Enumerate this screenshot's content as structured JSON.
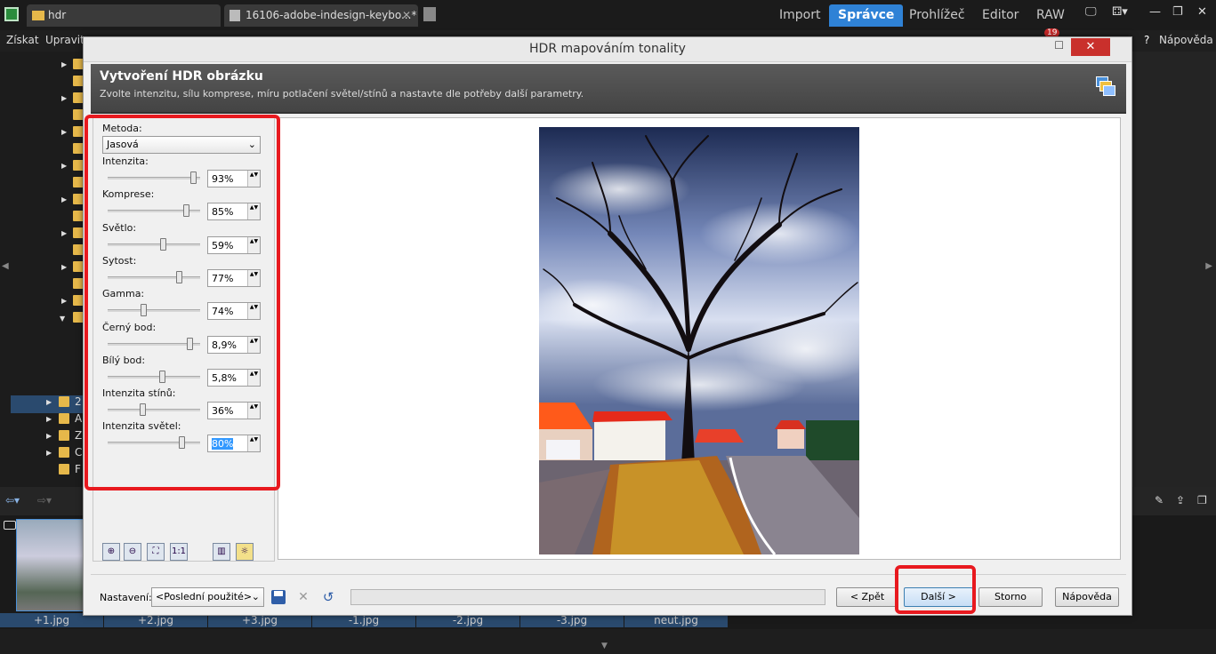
{
  "app": {
    "tabs": [
      {
        "label": "hdr"
      },
      {
        "label": "16106-adobe-indesign-keybo...*"
      }
    ],
    "modes": [
      "Import",
      "Správce",
      "Prohlížeč",
      "Editor",
      "RAW"
    ],
    "active_mode": "Správce",
    "menu": {
      "get": "Získat",
      "edit": "Upravit",
      "help": "Nápověda"
    },
    "notification_count": "19"
  },
  "filmstrip": {
    "files": [
      "+1.jpg",
      "+2.jpg",
      "+3.jpg",
      "-1.jpg",
      "-2.jpg",
      "-3.jpg",
      "neut.jpg"
    ]
  },
  "tree": {
    "labels": [
      "2",
      "A",
      "Z",
      "C",
      "F"
    ]
  },
  "dialog": {
    "title": "HDR mapováním tonality",
    "header_title": "Vytvoření HDR obrázku",
    "header_subtitle": "Zvolte intenzitu, sílu komprese, míru potlačení světel/stínů a nastavte dle potřeby další parametry.",
    "method_label": "Metoda:",
    "method_value": "Jasová",
    "sliders": [
      {
        "label": "Intenzita:",
        "value": "93%",
        "level": 0.93
      },
      {
        "label": "Komprese:",
        "value": "85%",
        "level": 0.85
      },
      {
        "label": "Světlo:",
        "value": "59%",
        "level": 0.59
      },
      {
        "label": "Sytost:",
        "value": "77%",
        "level": 0.77
      },
      {
        "label": "Gamma:",
        "value": "74%",
        "level": 0.37
      },
      {
        "label": "Černý bod:",
        "value": "8,9%",
        "level": 0.89
      },
      {
        "label": "Bílý bod:",
        "value": "5,8%",
        "level": 0.58
      },
      {
        "label": "Intenzita stínů:",
        "value": "36%",
        "level": 0.36
      },
      {
        "label": "Intenzita světel:",
        "value": "80%",
        "level": 0.8
      }
    ],
    "zoom_buttons": [
      "zoom-in",
      "zoom-out",
      "fit",
      "1:1"
    ],
    "zoom_one_to_one": "1:1",
    "settings_label": "Nastavení:",
    "settings_value": "<Poslední použité>",
    "buttons": {
      "back": "< Zpět",
      "next": "Další >",
      "cancel": "Storno",
      "help": "Nápověda"
    },
    "close_glyph": "✕"
  },
  "colors": {
    "accent": "#2f82d6",
    "highlight_red": "#e8191f"
  }
}
